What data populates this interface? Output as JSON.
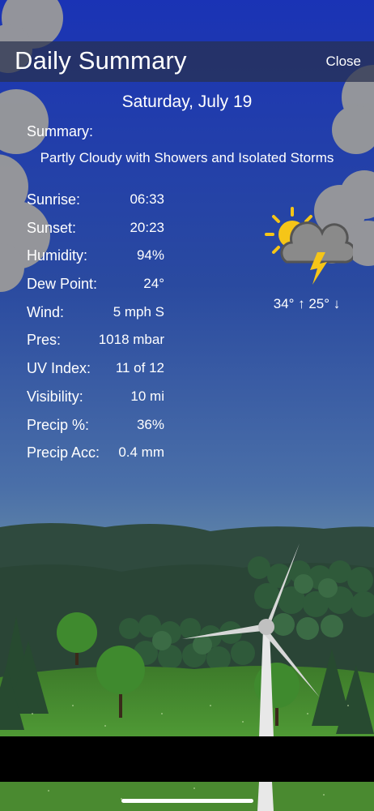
{
  "header": {
    "title": "Daily Summary",
    "close_label": "Close"
  },
  "date": "Saturday, July 19",
  "summary": {
    "label": "Summary:",
    "text": "Partly Cloudy with Showers and Isolated Storms"
  },
  "details": [
    {
      "key": "Sunrise:",
      "value": "06:33"
    },
    {
      "key": "Sunset:",
      "value": "20:23"
    },
    {
      "key": "Humidity:",
      "value": "94%"
    },
    {
      "key": "Dew Point:",
      "value": "24°"
    },
    {
      "key": "Wind:",
      "value": "5 mph S"
    },
    {
      "key": "Pres:",
      "value": "1018 mbar"
    },
    {
      "key": "UV Index:",
      "value": "11 of 12"
    },
    {
      "key": "Visibility:",
      "value": "10 mi"
    },
    {
      "key": "Precip %:",
      "value": "36%"
    },
    {
      "key": "Precip Acc:",
      "value": "0.4 mm"
    }
  ],
  "forecast": {
    "icon": "partly-cloudy-thunderstorm-icon",
    "temps": "34° ↑  25° ↓"
  },
  "colors": {
    "sky_top": "#1e3aa8",
    "sky_bottom": "#5f84a8",
    "grass": "#4a8a30",
    "hills": "#2d4a3a"
  }
}
